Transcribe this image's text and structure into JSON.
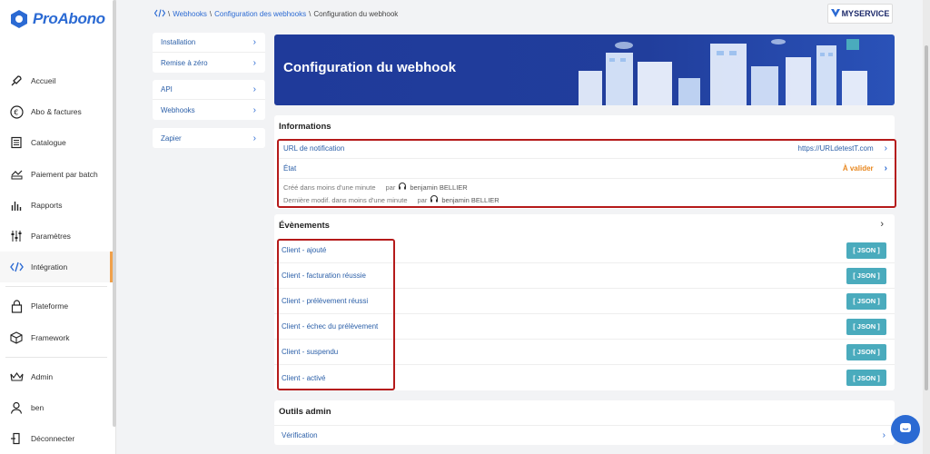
{
  "brand": {
    "name": "ProAbono"
  },
  "sidebar": {
    "items": [
      {
        "label": "Accueil",
        "icon": "rocket-icon"
      },
      {
        "label": "Abo & factures",
        "icon": "euro-icon"
      },
      {
        "label": "Catalogue",
        "icon": "catalog-icon"
      },
      {
        "label": "Paiement par batch",
        "icon": "batch-payment-icon"
      },
      {
        "label": "Rapports",
        "icon": "reports-icon"
      },
      {
        "label": "Paramètres",
        "icon": "sliders-icon"
      },
      {
        "label": "Intégration",
        "icon": "code-icon",
        "active": true
      },
      {
        "label": "Plateforme",
        "icon": "lock-icon"
      },
      {
        "label": "Framework",
        "icon": "cube-icon"
      },
      {
        "label": "Admin",
        "icon": "crown-icon"
      },
      {
        "label": "ben",
        "icon": "user-icon"
      },
      {
        "label": "Déconnecter",
        "icon": "logout-icon"
      }
    ]
  },
  "breadcrumb": {
    "sep": "\\",
    "webhooks": "Webhooks",
    "config_list": "Configuration des webhooks",
    "current": "Configuration du webhook"
  },
  "brand_switch": {
    "label": "MYSERVICE"
  },
  "submenu": {
    "group1": [
      "Installation",
      "Remise à zéro"
    ],
    "group2": [
      "API",
      "Webhooks"
    ],
    "group3": [
      "Zapier"
    ]
  },
  "hero": {
    "title": "Configuration du webhook"
  },
  "informations": {
    "title": "Informations",
    "url_label": "URL de notification",
    "url_value": "https://URLdetestT.com",
    "state_label": "État",
    "state_value": "À valider",
    "created_prefix": "Créé  dans moins d'une minute",
    "created_by": "par",
    "created_user": "benjamin BELLIER",
    "modified_prefix": "Dernière modif. dans moins d'une minute",
    "modified_by": "par",
    "modified_user": "benjamin BELLIER"
  },
  "events": {
    "title": "Évènements",
    "json_label": "[ JSON ]",
    "items": [
      "Client - ajouté",
      "Client - facturation réussie",
      "Client - prélèvement réussi",
      "Client - échec du prélèvement",
      "Client - suspendu",
      "Client - activé"
    ]
  },
  "admin_tools": {
    "title": "Outils admin",
    "verification": "Vérification"
  },
  "colors": {
    "accent": "#2b6ad3",
    "highlight": "#b51a1a",
    "json_button": "#4aabbd",
    "warning": "#e8871e"
  }
}
